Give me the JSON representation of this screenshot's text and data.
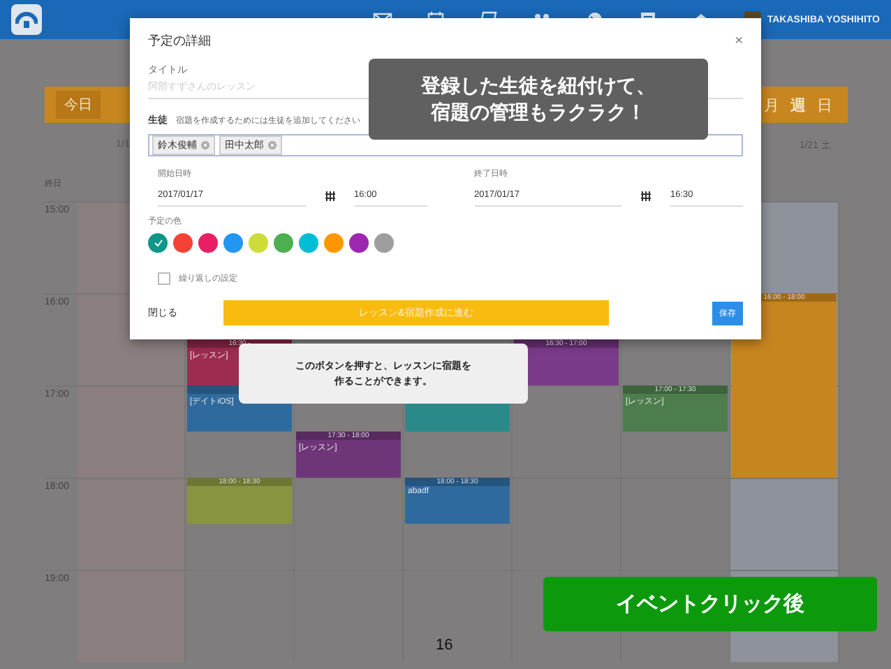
{
  "top_bar": {
    "user_name": "TAKASHIBA YOSHIHITO"
  },
  "calendar": {
    "today_button": "今日",
    "views": [
      {
        "label": "月",
        "selected": false
      },
      {
        "label": "週",
        "selected": true
      },
      {
        "label": "日",
        "selected": false
      }
    ],
    "days": [
      {
        "header": "1/1"
      },
      {
        "slots": [
          {
            "kind": "empty"
          },
          {
            "kind": "empty"
          },
          {
            "kind": "empty"
          },
          {
            "kind": "event",
            "time": "16:30 -",
            "title": "[レッスン]",
            "color": "#9c2c50"
          },
          {
            "kind": "event",
            "title": "[デイトiOS]",
            "color": "#2f6a9e"
          },
          {
            "kind": "empty"
          },
          {
            "kind": "event",
            "time": "18:00 - 18:30",
            "color": "#8a9440"
          }
        ]
      },
      {
        "slots": [
          {
            "kind": "empty"
          },
          {
            "kind": "empty"
          },
          {
            "kind": "empty"
          },
          {
            "kind": "empty"
          },
          {
            "kind": "empty"
          },
          {
            "kind": "event",
            "time": "17:30 - 18:00",
            "title": "[レッスン]",
            "color": "#6e3578"
          }
        ]
      },
      {
        "slots": [
          {
            "kind": "empty"
          },
          {
            "kind": "empty"
          },
          {
            "kind": "empty"
          },
          {
            "kind": "empty"
          },
          {
            "kind": "event",
            "color": "#2a8a8a"
          },
          {
            "kind": "empty"
          },
          {
            "kind": "event",
            "time": "18:00 - 18:30",
            "title": "abadf",
            "color": "#2f6a9e"
          }
        ]
      },
      {
        "slots": [
          {
            "kind": "empty"
          },
          {
            "kind": "empty"
          },
          {
            "kind": "empty"
          },
          {
            "kind": "event",
            "time": "16:30 - 17:00",
            "color": "#7a3a8a"
          }
        ]
      },
      {
        "slots": [
          {
            "kind": "empty"
          },
          {
            "kind": "empty"
          },
          {
            "kind": "empty"
          },
          {
            "kind": "empty"
          },
          {
            "kind": "event",
            "time": "17:00 - 17:30",
            "title": "[レッスン]",
            "color": "#4d7d4d"
          }
        ]
      },
      {
        "header": "1/21 土",
        "slots": [
          {
            "kind": "empty"
          },
          {
            "kind": "empty"
          },
          {
            "kind": "event",
            "time": "16:00 - 18:00",
            "color": "#c7851f"
          },
          {
            "kind": "continued"
          },
          {
            "kind": "continued"
          },
          {
            "kind": "continued"
          }
        ]
      }
    ],
    "all_day_label": "終日",
    "hours": [
      "15:00",
      "16:00",
      "17:00",
      "18:00",
      "19:00"
    ]
  },
  "dialog": {
    "title": "予定の詳細",
    "close": "×",
    "title_label": "タイトル",
    "title_placeholder": "阿部すずさんのレッスン",
    "students_label": "生徒",
    "students_hint": "宿題を作成するためには生徒を追加してください",
    "students": [
      "鈴木俊輔",
      "田中太郎"
    ],
    "start": {
      "label": "開始日時",
      "date": "2017/01/17",
      "time": "16:00"
    },
    "end": {
      "label": "終了日時",
      "date": "2017/01/17",
      "time": "16:30"
    },
    "color_label": "予定の色",
    "colors": [
      {
        "color": "#0f9688",
        "selected": true
      },
      {
        "color": "#f44336",
        "selected": false
      },
      {
        "color": "#e91e63",
        "selected": false
      },
      {
        "color": "#2196f3",
        "selected": false
      },
      {
        "color": "#cddc39",
        "selected": false
      },
      {
        "color": "#4caf50",
        "selected": false
      },
      {
        "color": "#00bcd4",
        "selected": false
      },
      {
        "color": "#ff9800",
        "selected": false
      },
      {
        "color": "#9c27b0",
        "selected": false
      },
      {
        "color": "#9e9e9e",
        "selected": false
      }
    ],
    "repeat": {
      "label": "繰り返しの設定",
      "checked": false
    },
    "close_button": "閉じる",
    "proceed_button": "レッスン&宿題作成に進む",
    "save_button": "保存"
  },
  "callouts": {
    "top": [
      "登録した生徒を紐付けて、",
      "宿題の管理もラクラク！"
    ],
    "bottom": [
      "このボタンを押すと、レッスンに宿題を",
      "作ることができます。"
    ],
    "label": "イベントクリック後"
  },
  "page_number": "16"
}
